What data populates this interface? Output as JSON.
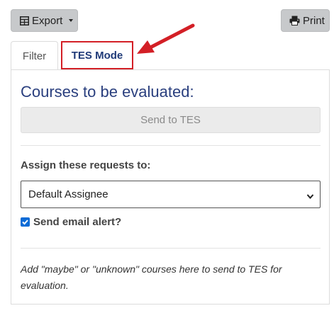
{
  "toolbar": {
    "export_label": "Export",
    "export_icon": "table-icon",
    "print_label": "Print",
    "print_icon": "printer-icon"
  },
  "tabs": [
    {
      "label": "Filter",
      "active": false
    },
    {
      "label": "TES Mode",
      "active": true,
      "highlighted": true
    }
  ],
  "panel": {
    "title": "Courses to be evaluated:",
    "send_button_label": "Send to TES",
    "assign_label": "Assign these requests to:",
    "assignee_select": {
      "selected": "Default Assignee"
    },
    "email_alert": {
      "label": "Send email alert?",
      "checked": true
    },
    "note": "Add \"maybe\" or \"unknown\" courses here to send to TES for evaluation."
  },
  "colors": {
    "highlight_red": "#d31f26",
    "title_blue": "#2a3f7e",
    "checkbox_blue": "#0b6bd6"
  }
}
